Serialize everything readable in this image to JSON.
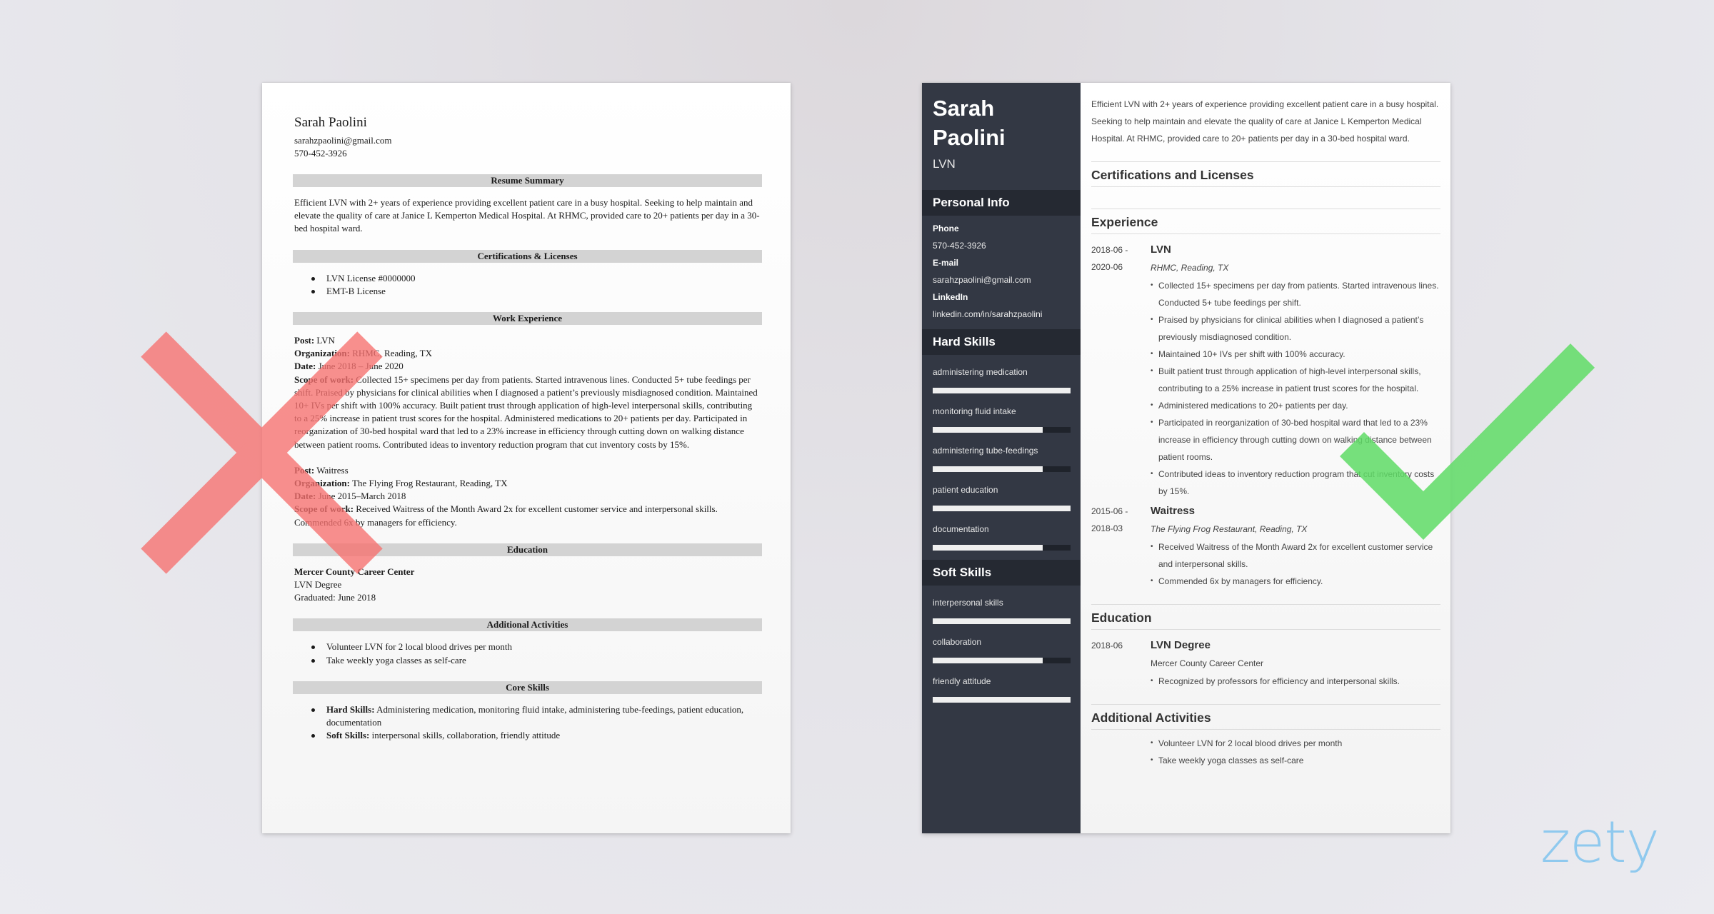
{
  "bad_resume": {
    "name": "Sarah Paolini",
    "email": "sarahzpaolini@gmail.com",
    "phone": "570-452-3926",
    "summary_heading": "Resume Summary",
    "summary": "Efficient LVN with 2+ years of experience providing excellent patient care in a busy hospital. Seeking to help maintain and elevate the quality of care at Janice L Kemperton Medical Hospital. At RHMC, provided care to 20+ patients per day in a 30-bed hospital ward.",
    "certs_heading": "Certifications & Licenses",
    "certs": [
      "LVN License #0000000",
      "EMT-B License"
    ],
    "work_heading": "Work Experience",
    "labels": {
      "post": "Post:",
      "organization": "Organization:",
      "date": "Date:",
      "scope": "Scope of work:"
    },
    "jobs": [
      {
        "post": "LVN",
        "organization": "RHMC, Reading, TX",
        "date": "June 2018 – June 2020",
        "scope": "Collected 15+ specimens per day from patients. Started intravenous lines. Conducted 5+ tube feedings per shift. Praised by physicians for clinical abilities when I diagnosed a patient’s previously misdiagnosed condition. Maintained 10+ IVs per shift with 100% accuracy. Built patient trust through application of high-level interpersonal skills, contributing to a 25% increase in patient trust scores for the hospital. Administered medications to 20+ patients per day. Participated in reorganization of 30-bed hospital ward that led to a 23% increase in efficiency through cutting down on walking distance between patient rooms. Contributed ideas to inventory reduction program that cut inventory costs by 15%."
      },
      {
        "post": "Waitress",
        "organization": "The Flying Frog Restaurant, Reading, TX",
        "date": "June 2015–March 2018",
        "scope": " Received Waitress of the Month Award 2x for excellent customer service and interpersonal skills. Commended 6x by managers for efficiency."
      }
    ],
    "education_heading": "Education",
    "education": {
      "school": "Mercer County Career Center",
      "degree": "LVN Degree",
      "graduated": "Graduated: June 2018"
    },
    "activities_heading": "Additional Activities",
    "activities": [
      "Volunteer LVN for 2 local blood drives per month",
      "Take weekly yoga classes as self-care"
    ],
    "skills_heading": "Core Skills",
    "skills": [
      {
        "label": "Hard Skills:",
        "text": " Administering medication, monitoring fluid intake, administering tube-feedings, patient education, documentation"
      },
      {
        "label": "Soft Skills:",
        "text": " interpersonal skills, collaboration, friendly attitude"
      }
    ]
  },
  "good_resume": {
    "first_name": "Sarah",
    "last_name": "Paolini",
    "job_title": "LVN",
    "personal_info_heading": "Personal Info",
    "personal_info": [
      {
        "label": "Phone",
        "value": "570-452-3926"
      },
      {
        "label": "E-mail",
        "value": "sarahzpaolini@gmail.com"
      },
      {
        "label": "LinkedIn",
        "value": "linkedin.com/in/sarahzpaolini"
      }
    ],
    "hard_skills_heading": "Hard Skills",
    "hard_skills": [
      {
        "name": "administering medication",
        "level": 1.0
      },
      {
        "name": "monitoring fluid intake",
        "level": 0.8
      },
      {
        "name": "administering tube-feedings",
        "level": 0.8
      },
      {
        "name": "patient education",
        "level": 1.0
      },
      {
        "name": "documentation",
        "level": 0.8
      }
    ],
    "soft_skills_heading": "Soft Skills",
    "soft_skills": [
      {
        "name": "interpersonal skills",
        "level": 1.0
      },
      {
        "name": "collaboration",
        "level": 0.8
      },
      {
        "name": "friendly attitude",
        "level": 1.0
      }
    ],
    "summary": "Efficient LVN with 2+ years of experience providing excellent patient care in a busy hospital. Seeking to help maintain and elevate the quality of care at Janice L Kemperton Medical Hospital. At RHMC, provided care to 20+ patients per day in a 30-bed hospital ward.",
    "certs_heading": "Certifications and Licenses",
    "experience_heading": "Experience",
    "experience": [
      {
        "date_start": "2018-06 -",
        "date_end": "2020-06",
        "title": "LVN",
        "org": "RHMC, Reading, TX",
        "bullets": [
          "Collected 15+ specimens per day from patients. Started intravenous lines. Conducted 5+ tube feedings per shift.",
          "Praised by physicians for clinical abilities when I diagnosed a patient’s previously misdiagnosed condition.",
          "Maintained 10+ IVs per shift with 100% accuracy.",
          "Built patient trust through application of high-level interpersonal skills, contributing to a 25% increase in patient trust scores for the hospital.",
          "Administered medications to 20+ patients per day.",
          "Participated in reorganization of 30-bed hospital ward that led to a 23% increase in efficiency through cutting down on walking distance between patient rooms.",
          "Contributed ideas to inventory reduction program that cut inventory costs by 15%."
        ]
      },
      {
        "date_start": "2015-06 -",
        "date_end": "2018-03",
        "title": "Waitress",
        "org": "The Flying Frog Restaurant, Reading, TX",
        "bullets": [
          "Received Waitress of the Month Award 2x for excellent customer service and interpersonal skills.",
          "Commended 6x by managers for efficiency."
        ]
      }
    ],
    "education_heading": "Education",
    "education": {
      "date": "2018-06",
      "degree": "LVN Degree",
      "school": "Mercer County Career Center",
      "bullets": [
        "Recognized by professors for efficiency and interpersonal skills."
      ]
    },
    "activities_heading": "Additional Activities",
    "activities": [
      "Volunteer LVN for 2 local blood drives per month",
      "Take weekly yoga classes as self-care"
    ]
  },
  "marks": {
    "bad_mark": "x-mark",
    "bad_color": "#f7716f",
    "good_mark": "check-mark",
    "good_color": "#5fdc66"
  },
  "brand": {
    "logo_text": "zety",
    "logo_color": "#8fc9ee"
  }
}
